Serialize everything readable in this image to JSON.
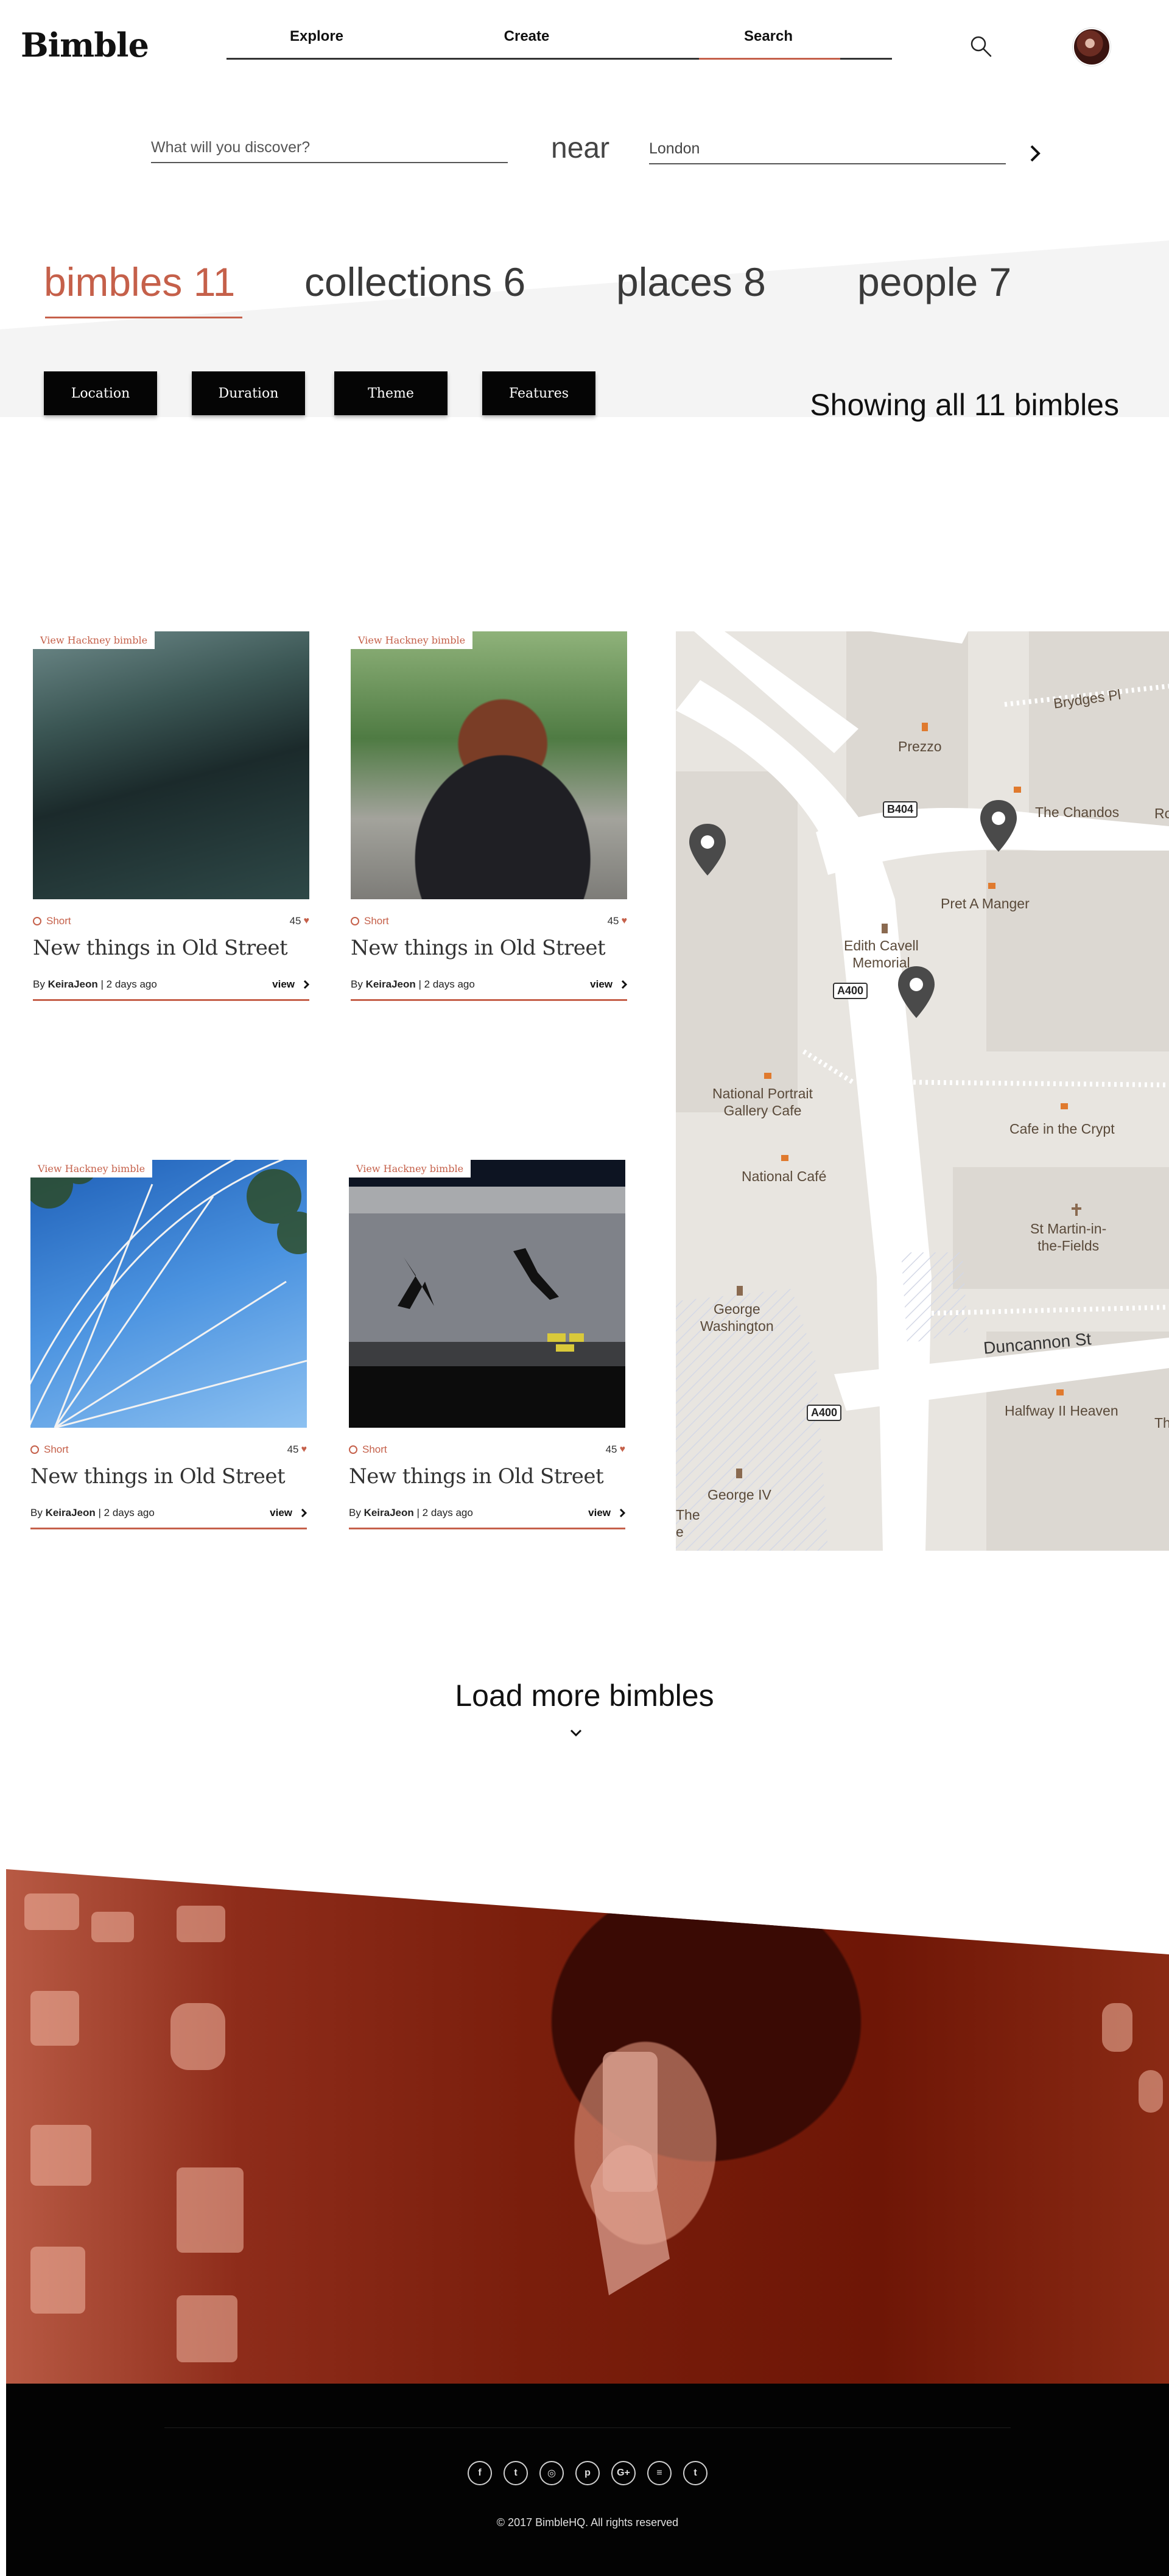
{
  "brand": {
    "logo": "Bimble",
    "accent_color": "#c5604a"
  },
  "nav": {
    "items": [
      {
        "label": "Explore"
      },
      {
        "label": "Create"
      },
      {
        "label": "Search",
        "active": true
      }
    ],
    "search_icon": "search-icon",
    "avatar_icon": "user-avatar"
  },
  "search": {
    "what_placeholder": "What will you discover?",
    "near_label": "near",
    "near_value": "London",
    "go_icon": "chevron-right-icon"
  },
  "tabs": [
    {
      "label": "bimbles 11",
      "active": true
    },
    {
      "label": "collections 6"
    },
    {
      "label": "places 8"
    },
    {
      "label": "people 7"
    }
  ],
  "filters": [
    {
      "label": "Location"
    },
    {
      "label": "Duration"
    },
    {
      "label": "Theme"
    },
    {
      "label": "Features"
    }
  ],
  "results_summary": "Showing all 11 bimbles",
  "cards": [
    {
      "tag": "View Hackney bimble",
      "duration": "Short",
      "likes": "45",
      "title": "New things in Old Street",
      "by": "By",
      "author": "KeiraJeon",
      "time": "| 2 days ago",
      "view": "view"
    },
    {
      "tag": "View Hackney bimble",
      "duration": "Short",
      "likes": "45",
      "title": "New things in Old Street",
      "by": "By",
      "author": "KeiraJeon",
      "time": "| 2 days ago",
      "view": "view"
    },
    {
      "tag": "View Hackney bimble",
      "duration": "Short",
      "likes": "45",
      "title": "New things in Old Street",
      "by": "By",
      "author": "KeiraJeon",
      "time": "| 2 days ago",
      "view": "view"
    },
    {
      "tag": "View Hackney bimble",
      "duration": "Short",
      "likes": "45",
      "title": "New things in Old Street",
      "by": "By",
      "author": "KeiraJeon",
      "time": "| 2 days ago",
      "view": "view"
    }
  ],
  "map": {
    "labels": {
      "brydges": "Brydges Pl",
      "prezzo": "Prezzo",
      "chandos": "The Chandos",
      "ro": "Ro",
      "b404": "B404",
      "pret": "Pret A Manger",
      "edith": "Edith Cavell\nMemorial",
      "a400_top": "A400",
      "npg_cafe": "National Portrait\nGallery Cafe",
      "national_cafe": "National Café",
      "crypt": "Cafe in the Crypt",
      "martin": "St Martin-in-\nthe-Fields",
      "george_w": "George\nWashington",
      "duncannon": "Duncannon St",
      "a400_bottom": "A400",
      "halfway": "Halfway II Heaven",
      "th": "Th",
      "george_iv": "George IV",
      "the": "The\ne"
    }
  },
  "load_more": {
    "label": "Load more bimbles",
    "icon": "chevron-down-icon"
  },
  "footer": {
    "social": [
      {
        "glyph": "f",
        "icon": "facebook-icon"
      },
      {
        "glyph": "t",
        "icon": "twitter-icon"
      },
      {
        "glyph": "◎",
        "icon": "instagram-icon"
      },
      {
        "glyph": "p",
        "icon": "pinterest-icon"
      },
      {
        "glyph": "G+",
        "icon": "google-plus-icon"
      },
      {
        "glyph": "≡",
        "icon": "email-icon"
      },
      {
        "glyph": "t",
        "icon": "tumblr-icon"
      }
    ],
    "copyright": "© 2017 BimbleHQ. All rights reserved"
  }
}
